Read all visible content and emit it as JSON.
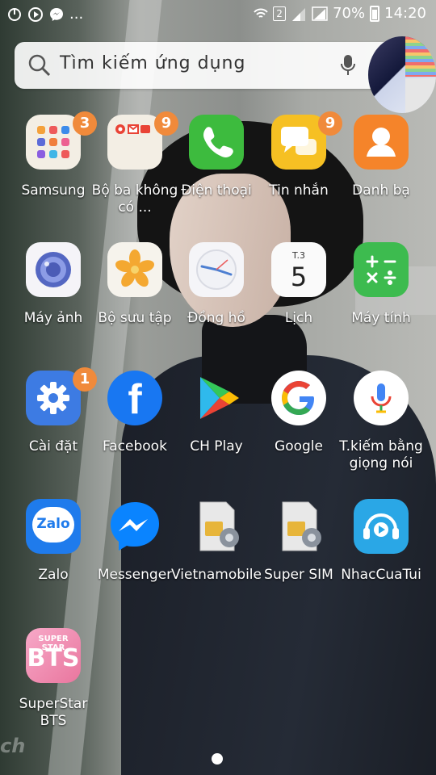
{
  "status": {
    "battery": "70%",
    "time": "14:20",
    "sim_badge": "2",
    "more": "..."
  },
  "search": {
    "placeholder": "Tìm kiếm ứng dụng"
  },
  "apps": [
    {
      "label": "Samsung",
      "badge": "3",
      "icon": "samsung-folder-icon"
    },
    {
      "label": "Bộ ba không có ...",
      "badge": "9",
      "icon": "google-folder-icon"
    },
    {
      "label": "Điện thoại",
      "icon": "phone-icon"
    },
    {
      "label": "Tin nhắn",
      "badge": "9",
      "icon": "messages-icon"
    },
    {
      "label": "Danh bạ",
      "icon": "contacts-icon"
    },
    {
      "label": "Máy ảnh",
      "icon": "camera-icon"
    },
    {
      "label": "Bộ sưu tập",
      "icon": "gallery-icon"
    },
    {
      "label": "Đồng hồ",
      "icon": "clock-icon"
    },
    {
      "label": "Lịch",
      "icon": "calendar-icon",
      "cal_day": "T.3",
      "cal_num": "5"
    },
    {
      "label": "Máy tính",
      "icon": "calculator-icon"
    },
    {
      "label": "Cài đặt",
      "badge": "1",
      "icon": "settings-icon"
    },
    {
      "label": "Facebook",
      "icon": "facebook-icon"
    },
    {
      "label": "CH Play",
      "icon": "play-store-icon"
    },
    {
      "label": "Google",
      "icon": "google-icon"
    },
    {
      "label": "T.kiếm bằng giọng nói",
      "icon": "voice-search-icon"
    },
    {
      "label": "Zalo",
      "icon": "zalo-icon"
    },
    {
      "label": "Messenger",
      "icon": "messenger-icon"
    },
    {
      "label": "Vietnamobile",
      "icon": "sim-toolkit-icon"
    },
    {
      "label": "Super SIM",
      "icon": "sim-toolkit-icon"
    },
    {
      "label": "NhacCuaTui",
      "icon": "nhaccuatui-icon"
    },
    {
      "label": "SuperStar BTS",
      "icon": "superstar-bts-icon"
    }
  ],
  "icon_text": {
    "zalo": "Zalo",
    "bts_top": "SUPER STAR",
    "bts_main": "BTS",
    "facebook": "f",
    "google": "G",
    "calc": "+−×÷"
  },
  "wallpaper_watermark": "ch",
  "colors": {
    "badge": "#f08a3b",
    "phone": "#3dbb3e",
    "messages": "#f6c023",
    "contacts": "#f5842a",
    "calculator": "#3dbb4f"
  }
}
